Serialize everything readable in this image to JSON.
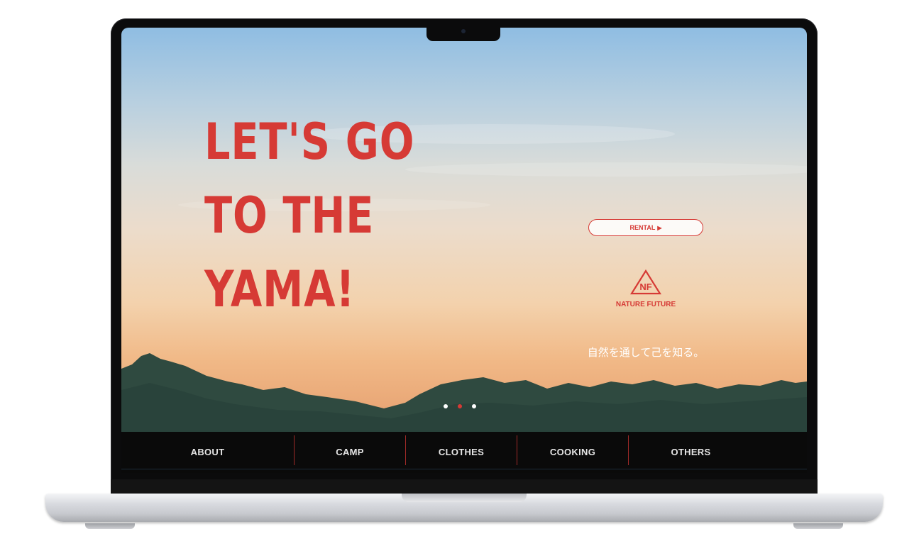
{
  "hero": {
    "headline_lines": [
      "LET'S GO",
      "TO THE",
      "YAMA!"
    ],
    "tagline": "自然を通して己を知る。"
  },
  "rental_button": {
    "label": "RENTAL",
    "icon": "play-triangle-icon"
  },
  "brand": {
    "logo_letters": "NF",
    "name": "NATURE FUTURE"
  },
  "carousel": {
    "slide_count": 3,
    "active_index": 1
  },
  "nav": {
    "items": [
      {
        "label": "ABOUT"
      },
      {
        "label": "CAMP"
      },
      {
        "label": "CLOTHES"
      },
      {
        "label": "COOKING"
      },
      {
        "label": "OTHERS"
      }
    ]
  },
  "colors": {
    "accent_red": "#d63a35",
    "nav_bg": "#0a0a0a",
    "nav_text": "#e6e6e6",
    "mountain": "#2f4a40"
  }
}
